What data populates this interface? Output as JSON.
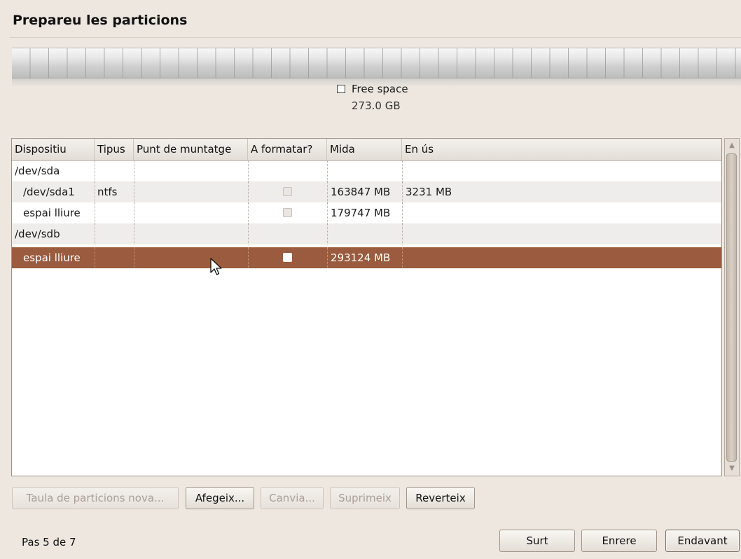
{
  "header": {
    "title": "Prepareu les particions"
  },
  "disk_bar": {
    "legend_label": "Free space",
    "legend_size": "273.0 GB",
    "legend_color": "#ffffff"
  },
  "table": {
    "columns": [
      "Dispositiu",
      "Tipus",
      "Punt de muntatge",
      "A formatar?",
      "Mida",
      "En ús"
    ],
    "rows": [
      {
        "device": "/dev/sda",
        "type": "",
        "mount": "",
        "format": null,
        "size": "",
        "used": ""
      },
      {
        "device": "/dev/sda1",
        "type": "ntfs",
        "mount": "",
        "format": false,
        "size": "163847 MB",
        "used": "3231 MB"
      },
      {
        "device": "espai lliure",
        "type": "",
        "mount": "",
        "format": false,
        "size": "179747 MB",
        "used": ""
      },
      {
        "device": "/dev/sdb",
        "type": "",
        "mount": "",
        "format": null,
        "size": "",
        "used": ""
      },
      {
        "device": "espai lliure",
        "type": "",
        "mount": "",
        "format": false,
        "size": "293124 MB",
        "used": "",
        "selected": true
      }
    ]
  },
  "actions": {
    "new_table": "Taula de particions nova...",
    "add": "Afegeix...",
    "change": "Canvia...",
    "delete": "Suprimeix",
    "revert": "Reverteix"
  },
  "footer": {
    "step": "Pas 5 de 7",
    "quit": "Surt",
    "back": "Enrere",
    "forward": "Endavant"
  },
  "colors": {
    "selection": "#9a5b3e",
    "window_bg": "#ede7e0"
  }
}
